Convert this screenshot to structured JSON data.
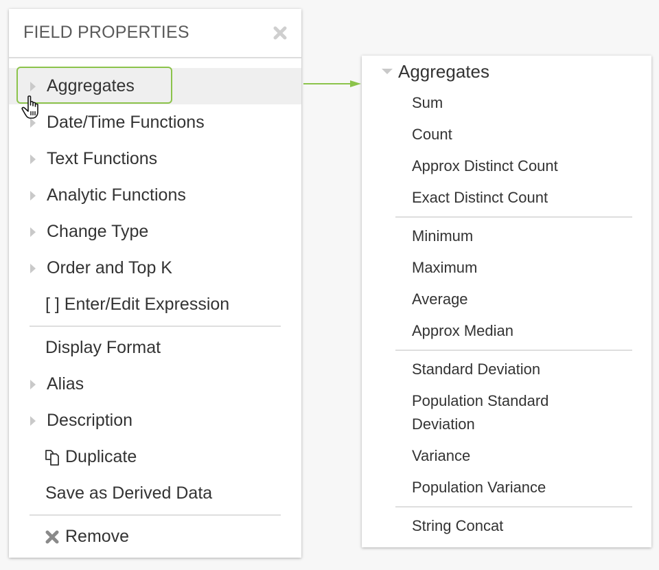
{
  "panel": {
    "title": "FIELD PROPERTIES",
    "close_icon": "close-x-icon",
    "groups": [
      {
        "items": [
          {
            "label": "Aggregates",
            "icon": "caret-right-icon",
            "active": true
          },
          {
            "label": "Date/Time Functions",
            "icon": "caret-right-icon"
          },
          {
            "label": "Text Functions",
            "icon": "caret-right-icon"
          },
          {
            "label": "Analytic Functions",
            "icon": "caret-right-icon"
          },
          {
            "label": "Change Type",
            "icon": "caret-right-icon"
          },
          {
            "label": "Order and Top K",
            "icon": "caret-right-icon"
          },
          {
            "label": "[ ] Enter/Edit Expression",
            "icon": null
          }
        ]
      },
      {
        "items": [
          {
            "label": "Display Format",
            "icon": null
          },
          {
            "label": "Alias",
            "icon": "caret-right-icon"
          },
          {
            "label": "Description",
            "icon": "caret-right-icon"
          },
          {
            "label": "Duplicate",
            "icon": "duplicate-icon"
          },
          {
            "label": "Save as Derived Data",
            "icon": null
          }
        ]
      },
      {
        "items": [
          {
            "label": "Remove",
            "icon": "remove-x-icon"
          }
        ]
      }
    ]
  },
  "submenu": {
    "title": "Aggregates",
    "groups": [
      [
        "Sum",
        "Count",
        "Approx Distinct Count",
        "Exact Distinct Count"
      ],
      [
        "Minimum",
        "Maximum",
        "Average",
        "Approx Median"
      ],
      [
        "Standard Deviation",
        "Population Standard Deviation",
        "Variance",
        "Population Variance"
      ],
      [
        "String Concat"
      ]
    ]
  },
  "colors": {
    "highlight": "#8bc34a",
    "arrow": "#8bc34a",
    "active_row": "#efefef",
    "caret": "#c9c9c9",
    "text": "#333333"
  }
}
